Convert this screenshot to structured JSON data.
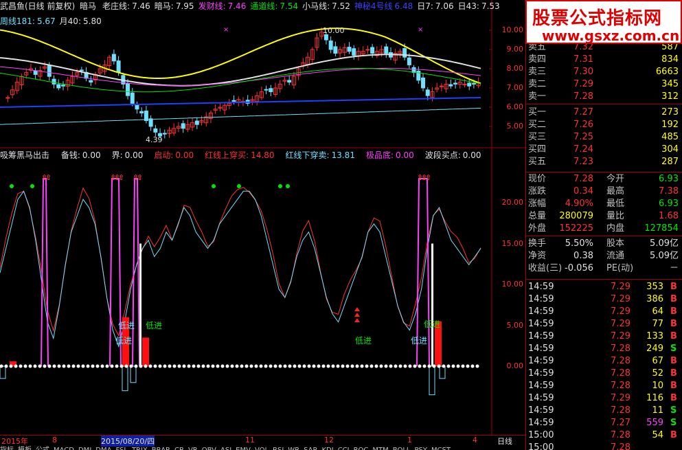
{
  "colors": {
    "bg": "#000000",
    "red": "#ff3232",
    "green": "#00e600",
    "yellow": "#ffff00",
    "border": "#a00000",
    "magenta": "#ff40ff",
    "cyan": "#6fe0ff"
  },
  "header": {
    "title": "武昌鱼(日线 前复权)",
    "items": [
      {
        "label": "暗马",
        "value": "",
        "color": "#e0e0e0"
      },
      {
        "label": "老庄线:",
        "value": "7.46",
        "color": "#e0e0e0"
      },
      {
        "label": "暗马:",
        "value": "7.95",
        "color": "#e0e0e0"
      },
      {
        "label": "发财线:",
        "value": "7.46",
        "color": "#ff40ff"
      },
      {
        "label": "通道线:",
        "value": "7.54",
        "color": "#00e600"
      },
      {
        "label": "小马线:",
        "value": "7.52",
        "color": "#e0e0e0"
      },
      {
        "label": "神秘4号线",
        "value": "6.48",
        "color": "#4040ff"
      },
      {
        "label": "日7:",
        "value": "7.06",
        "color": "#e0e0e0"
      },
      {
        "label": "日43:",
        "value": "7.53",
        "color": "#e0e0e0"
      }
    ],
    "line2": [
      {
        "label": "周线181:",
        "value": "5.67",
        "color": "#6fe0ff"
      },
      {
        "label": "月40:",
        "value": "5.80",
        "color": "#e0e0e0"
      }
    ]
  },
  "indicator_header": {
    "title": "吸筹黑马出击",
    "items": [
      {
        "label": "备钱:",
        "value": "0.00",
        "color": "#e0e0e0"
      },
      {
        "label": "界:",
        "value": "0.00",
        "color": "#e0e0e0"
      },
      {
        "label": "启动:",
        "value": "0.00",
        "color": "#ff3232"
      },
      {
        "label": "红线上穿买:",
        "value": "14.80",
        "color": "#ff3232"
      },
      {
        "label": "红线下穿卖:",
        "value": "13.81",
        "color": "#6fe0ff"
      },
      {
        "label": "极品底:",
        "value": "0.00",
        "color": "#ff40ff"
      },
      {
        "label": "波段买点:",
        "value": "0.00",
        "color": "#e0e0e0"
      }
    ]
  },
  "price_axis": [
    "10.00",
    "9.00",
    "8.00",
    "7.00",
    "6.00",
    "5.00"
  ],
  "ind_axis": [
    "20.00",
    "15.00",
    "10.00",
    "5.00",
    "0.00"
  ],
  "annotations": {
    "high": "10.00",
    "low": "4.39",
    "labels": [
      "低进",
      "低进",
      "低进",
      "低进",
      "低进"
    ]
  },
  "bottom": {
    "dates": [
      "2015年",
      "8",
      "2015/08/20/四",
      "11",
      "12",
      "1",
      "4"
    ],
    "period": "日线"
  },
  "tabs": [
    "指标",
    "模板",
    "公式",
    "MACD",
    "DMI",
    "DMA",
    "FSL",
    "TRIX",
    "BRAR",
    "CR",
    "VR",
    "OBV",
    "ASI",
    "EMV",
    "VOL",
    "RSI",
    "WR",
    "SAR",
    "KDJ",
    "CCI",
    "ROC",
    "MTM",
    "BOLL",
    "PSY",
    "MCST"
  ],
  "logo": {
    "line1": "股票公式指标网",
    "line2": "www.gsxz.com.cn"
  },
  "orderbook": {
    "asks": [
      {
        "label": "卖五",
        "price": "7.32",
        "vol": "587"
      },
      {
        "label": "卖四",
        "price": "7.31",
        "vol": "834"
      },
      {
        "label": "卖三",
        "price": "7.30",
        "vol": "6663"
      },
      {
        "label": "卖二",
        "price": "7.29",
        "vol": "345"
      },
      {
        "label": "卖一",
        "price": "7.28",
        "vol": "312"
      }
    ],
    "bids": [
      {
        "label": "买一",
        "price": "7.27",
        "vol": "273"
      },
      {
        "label": "买二",
        "price": "7.26",
        "vol": "192"
      },
      {
        "label": "买三",
        "price": "7.25",
        "vol": "485"
      },
      {
        "label": "买四",
        "price": "7.24",
        "vol": "304"
      },
      {
        "label": "买五",
        "price": "7.23",
        "vol": "287"
      }
    ]
  },
  "quote": {
    "xj_l": "现价",
    "xj": "7.28",
    "jk_l": "今开",
    "jk": "6.93",
    "zd_l": "涨跌",
    "zd": "0.34",
    "zg_l": "最高",
    "zg": "7.38",
    "zf_l": "涨幅",
    "zf": "4.90%",
    "zdi_l": "最低",
    "zdi": "6.93",
    "zl_l": "总量",
    "zl": "280079",
    "lb_l": "量比",
    "lb": "1.68",
    "wp_l": "外盘",
    "wp": "152225",
    "np_l": "内盘",
    "np": "127854",
    "hs_l": "换手",
    "hs": "5.50%",
    "gb_l": "股本",
    "gb": "5.09亿",
    "jz_l": "净资",
    "jz": "0.38",
    "lt_l": "流通",
    "lt": "5.09亿",
    "sy_l": "收益(三)",
    "sy": "-0.056",
    "pe_l": "PE(动)",
    "pe": "－"
  },
  "ticks": [
    {
      "t": "14:59",
      "p": "7.29",
      "v": "353",
      "bs": "B"
    },
    {
      "t": "14:59",
      "p": "7.29",
      "v": "386",
      "bs": "B"
    },
    {
      "t": "14:59",
      "p": "7.29",
      "v": "64",
      "bs": "B"
    },
    {
      "t": "14:59",
      "p": "7.29",
      "v": "77",
      "bs": "B"
    },
    {
      "t": "14:59",
      "p": "7.29",
      "v": "133",
      "bs": "B"
    },
    {
      "t": "14:59",
      "p": "7.28",
      "v": "249",
      "bs": "S"
    },
    {
      "t": "14:59",
      "p": "7.28",
      "v": "67",
      "bs": "B"
    },
    {
      "t": "14:59",
      "p": "7.28",
      "v": "52",
      "bs": "B"
    },
    {
      "t": "14:59",
      "p": "7.28",
      "v": "10",
      "bs": "B"
    },
    {
      "t": "14:59",
      "p": "7.29",
      "v": "116",
      "bs": "B"
    },
    {
      "t": "14:59",
      "p": "7.28",
      "v": "11",
      "bs": "S"
    },
    {
      "t": "14:59",
      "p": "7.27",
      "v": "559",
      "bs": "S"
    },
    {
      "t": "15:00",
      "p": "7.28",
      "v": "54",
      "bs": "B"
    },
    {
      "t": "15:00",
      "p": "7.28",
      "v": "",
      "bs": ""
    }
  ]
}
